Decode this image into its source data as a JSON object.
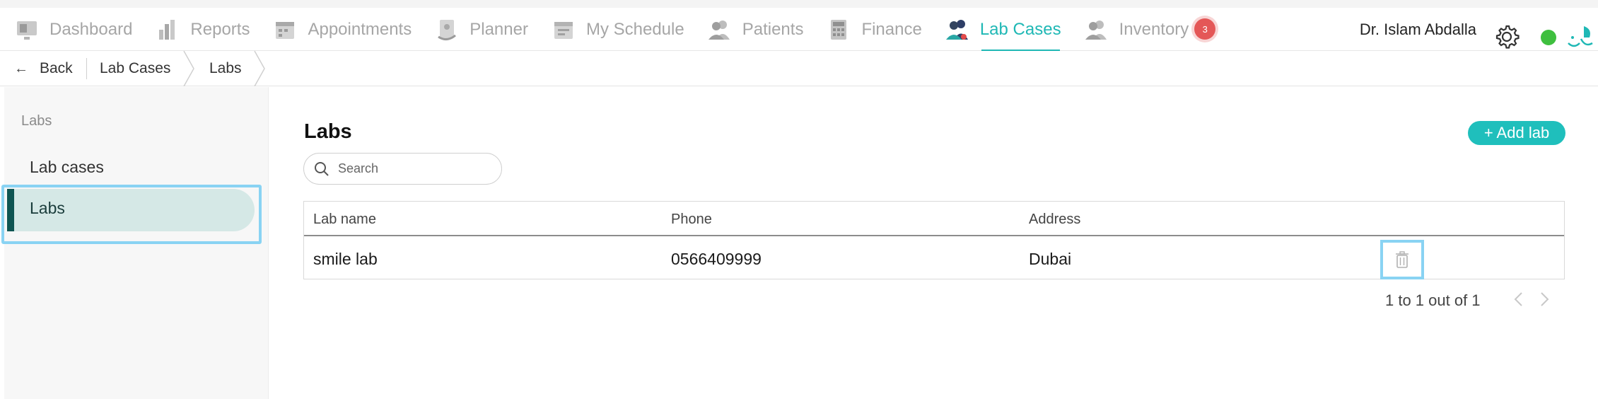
{
  "nav": {
    "items": [
      {
        "label": "Dashboard",
        "icon": "dashboard-icon"
      },
      {
        "label": "Reports",
        "icon": "reports-icon"
      },
      {
        "label": "Appointments",
        "icon": "appointments-icon"
      },
      {
        "label": "Planner",
        "icon": "planner-icon"
      },
      {
        "label": "My Schedule",
        "icon": "schedule-icon"
      },
      {
        "label": "Patients",
        "icon": "patients-icon"
      },
      {
        "label": "Finance",
        "icon": "finance-icon"
      },
      {
        "label": "Lab Cases",
        "icon": "lab-cases-icon",
        "active": true
      },
      {
        "label": "Inventory",
        "icon": "inventory-icon"
      }
    ],
    "inventory_badge": "3",
    "user_name": "Dr. Islam Abdalla"
  },
  "breadcrumb": {
    "back_label": "Back",
    "items": [
      "Lab Cases",
      "Labs"
    ]
  },
  "sidebar": {
    "heading": "Labs",
    "items": [
      {
        "label": "Lab cases"
      },
      {
        "label": "Labs",
        "active": true
      }
    ]
  },
  "main": {
    "title": "Labs",
    "add_button": "+ Add lab",
    "search_placeholder": "Search",
    "search_value": "",
    "columns": [
      "Lab name",
      "Phone",
      "Address"
    ],
    "rows": [
      {
        "name": "smile lab",
        "phone": "0566409999",
        "address": "Dubai"
      }
    ],
    "pagination_text": "1 to 1 out of 1"
  },
  "colors": {
    "accent": "#1fb8b5",
    "badge": "#e45757",
    "status_online": "#3fbf3f",
    "sidebar_active": "#d5e8e6",
    "highlight_outline": "#89d3f3"
  }
}
